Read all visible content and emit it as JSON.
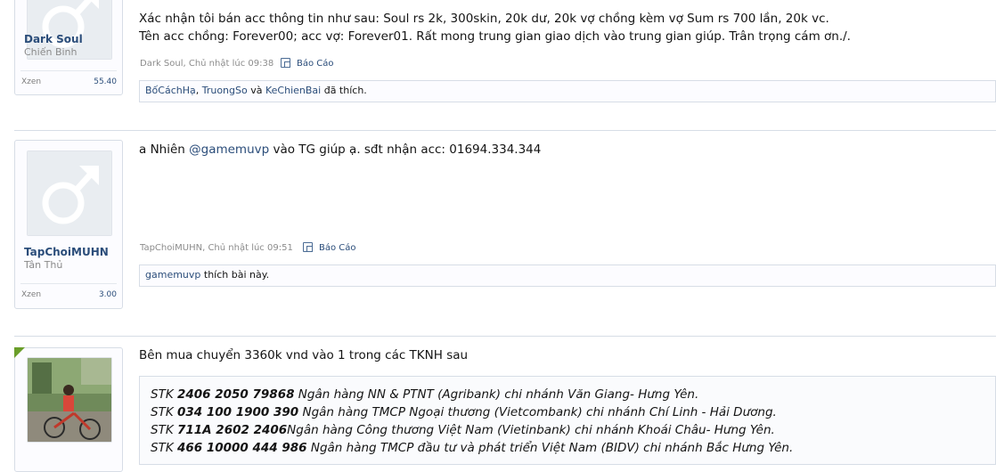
{
  "posts": [
    {
      "user": {
        "name": "Dark Soul",
        "title": "Chiến Binh",
        "stat_label": "Xzen",
        "stat_value": "55.40"
      },
      "message_lines": [
        "Xác nhận tôi bán acc thông tin như sau: Soul rs 2k, 300skin, 20k dư, 20k vợ chồng kèm vợ Sum rs 700 lần, 20k vc.",
        "Tên acc chồng: Forever00; acc vợ: Forever01. Rất mong trung gian giao dịch vào trung gian giúp. Trân trọng cám ơn./."
      ],
      "meta": "Dark Soul, Chủ nhật lúc 09:38",
      "report_label": "Báo Cáo",
      "likes": {
        "users": [
          "BốCáchHạ",
          "TruongSo",
          "KeChienBai"
        ],
        "separator": ", ",
        "and": " và ",
        "suffix": " đã thích."
      }
    },
    {
      "user": {
        "name": "TapChoiMUHN",
        "title": "Tân Thủ",
        "stat_label": "Xzen",
        "stat_value": "3.00"
      },
      "message": {
        "prefix": "a Nhiên ",
        "mention": "@gamemuvp",
        "suffix": " vào TG giúp ạ. sđt nhận acc: 01694.334.344"
      },
      "meta": "TapChoiMUHN, Chủ nhật lúc 09:51",
      "report_label": "Báo Cáo",
      "likes": {
        "user": "gamemuvp",
        "suffix": " thích bài này."
      }
    },
    {
      "message": "Bên mua chuyển 3360k vnd vào 1 trong các TKNH sau",
      "accounts": [
        {
          "prefix": "STK ",
          "number": "2406 2050 79868",
          "bank": " Ngân hàng NN & PTNT (Agribank) chi nhánh Văn Giang- Hưng Yên."
        },
        {
          "prefix": "STK ",
          "number": "034 100 1900 390",
          "bank": " Ngân hàng TMCP Ngoại thương (Vietcombank) chi nhánh Chí Linh - Hải Dương."
        },
        {
          "prefix": "STK ",
          "number": "711A 2602 2406",
          "bank": "Ngân hàng Công thương Việt Nam (Vietinbank) chi nhánh Khoái Châu- Hưng Yên."
        },
        {
          "prefix": "STK ",
          "number": "466 10000 444 986",
          "bank": " Ngân hàng TMCP đầu tư và phát triển Việt Nam (BIDV) chi nhánh Bắc Hưng Yên."
        }
      ]
    }
  ],
  "colors": {
    "link": "#2b4d7a",
    "border": "#d7dde6",
    "staff_corner": "#6a9e2a"
  },
  "icons": [
    "male-default-avatar-icon",
    "report-icon"
  ]
}
